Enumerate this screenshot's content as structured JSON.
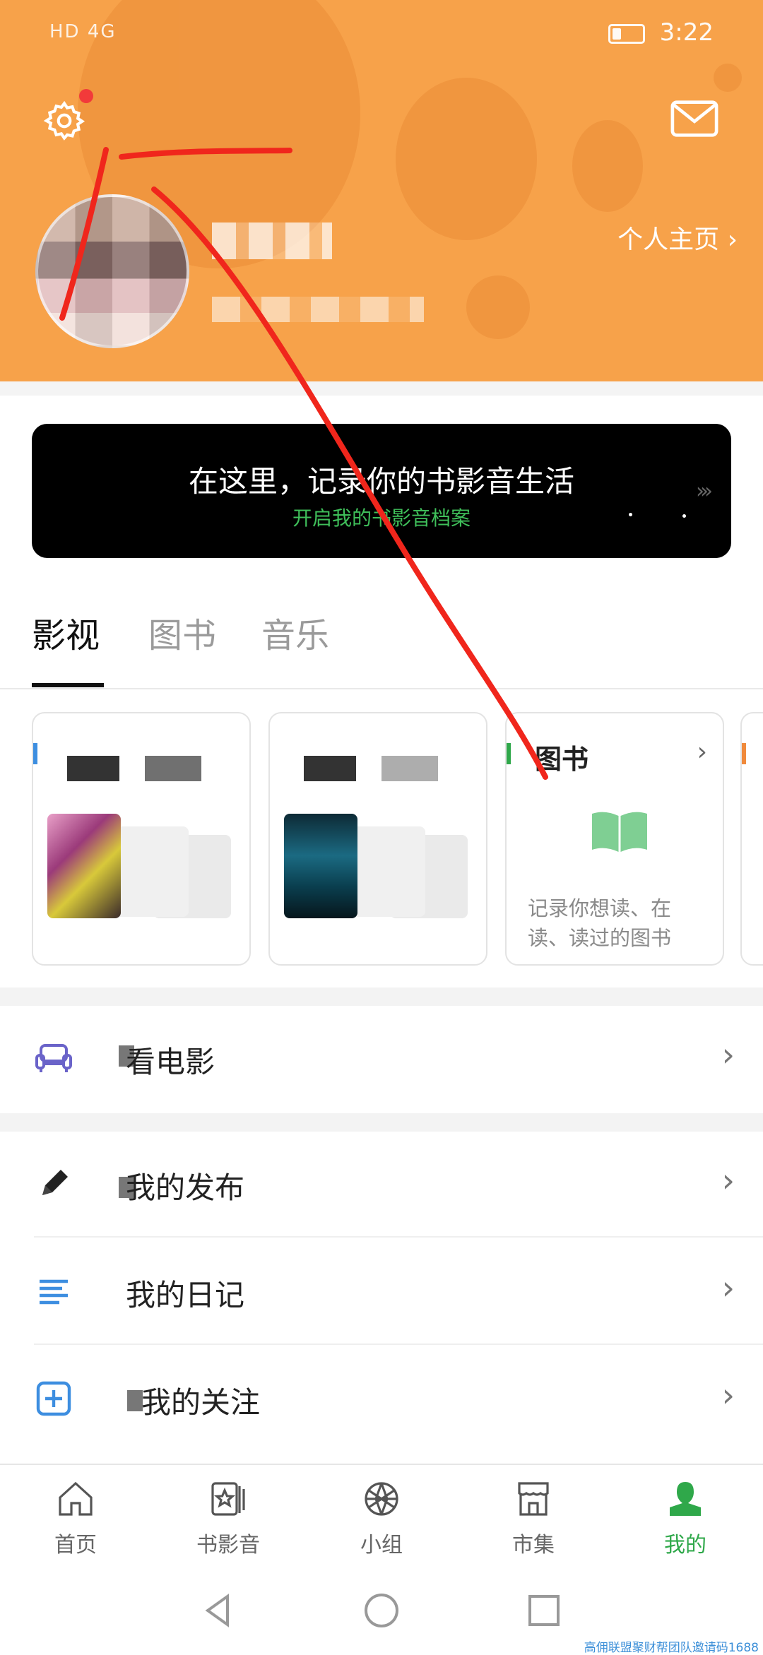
{
  "statusbar": {
    "left": "HD 4G",
    "time": "3:22"
  },
  "header": {
    "profile_link": "个人主页 ›"
  },
  "banner": {
    "title": "在这里，记录你的书影音生活",
    "subtitle": "开启我的书影音档案",
    "arrow": "›››"
  },
  "tabs": [
    {
      "label": "影视"
    },
    {
      "label": "图书"
    },
    {
      "label": "音乐"
    }
  ],
  "cards": {
    "book": {
      "title": "图书",
      "chevron": "›",
      "desc": "记录你想读、在读、读过的图书"
    }
  },
  "list": [
    {
      "label": "看电影",
      "chevron": "›"
    },
    {
      "label": "我的发布",
      "chevron": "›"
    },
    {
      "label": "我的日记",
      "chevron": "›"
    },
    {
      "label": "我的关注",
      "chevron": "›"
    }
  ],
  "nav": [
    {
      "label": "首页"
    },
    {
      "label": "书影音"
    },
    {
      "label": "小组"
    },
    {
      "label": "市集"
    },
    {
      "label": "我的"
    }
  ],
  "colors": {
    "header": "#f7a24a",
    "accent": "#2fa84a",
    "annotation": "#f0261c"
  },
  "watermark": "高佣联盟聚财帮团队邀请码1688"
}
